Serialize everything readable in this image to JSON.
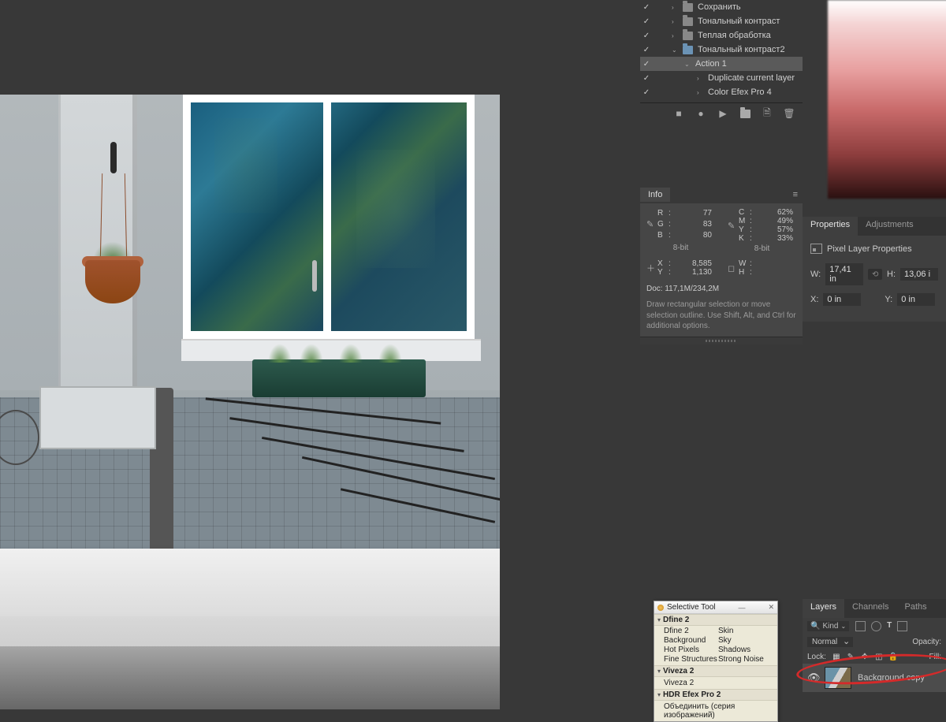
{
  "actions": {
    "items": [
      {
        "indent": 0,
        "checked": true,
        "caret": "›",
        "folder": "closed",
        "label": "Сохранить"
      },
      {
        "indent": 0,
        "checked": true,
        "caret": "›",
        "folder": "closed",
        "label": "Тональный контраст"
      },
      {
        "indent": 0,
        "checked": true,
        "caret": "›",
        "folder": "closed",
        "label": "Теплая обработка"
      },
      {
        "indent": 0,
        "checked": true,
        "caret": "⌄",
        "folder": "open",
        "label": "Тональный контраст2"
      },
      {
        "indent": 1,
        "checked": true,
        "caret": "⌄",
        "folder": "",
        "label": "Action 1",
        "selected": true
      },
      {
        "indent": 2,
        "checked": true,
        "caret": "›",
        "folder": "",
        "label": "Duplicate current layer"
      },
      {
        "indent": 2,
        "checked": true,
        "caret": "›",
        "folder": "",
        "label": "Color Efex Pro 4"
      }
    ],
    "toolbar": [
      "stop-icon",
      "record-icon",
      "play-icon",
      "new-set-icon",
      "new-action-icon",
      "trash-icon"
    ]
  },
  "info": {
    "title": "Info",
    "rgb": {
      "R": "77",
      "G": "83",
      "B": "80",
      "mode": "8-bit"
    },
    "cmyk": {
      "C": "62%",
      "M": "49%",
      "Y": "57%",
      "K": "33%",
      "mode": "8-bit"
    },
    "xy": {
      "X": "8,585",
      "Y": "1,130"
    },
    "wh": {
      "W": "",
      "H": ""
    },
    "doc": "Doc: 117,1M/234,2M",
    "hint": "Draw rectangular selection or move selection outline.  Use Shift, Alt, and Ctrl for additional options."
  },
  "properties": {
    "tabs": [
      "Properties",
      "Adjustments"
    ],
    "title": "Pixel Layer Properties",
    "W_label": "W:",
    "W": "17,41 in",
    "H_label": "H:",
    "H": "13,06 i",
    "X_label": "X:",
    "X": "0 in",
    "Y_label": "Y:",
    "Y": "0 in"
  },
  "layers": {
    "tabs": [
      "Layers",
      "Channels",
      "Paths"
    ],
    "kind_label": "Kind",
    "kind_icon": "🔍",
    "blend": "Normal",
    "opacity_label": "Opacity:",
    "lock_label": "Lock:",
    "fill_label": "Fill:",
    "layer0": "Background copy"
  },
  "selective": {
    "title": "Selective Tool",
    "sections": [
      {
        "head": "Dfine 2",
        "rows": [
          [
            "Dfine 2",
            "Skin"
          ],
          [
            "Background",
            "Sky"
          ],
          [
            "Hot Pixels",
            "Shadows"
          ],
          [
            "Fine Structures",
            "Strong Noise"
          ]
        ]
      },
      {
        "head": "Viveza 2",
        "single": "Viveza 2"
      },
      {
        "head": "HDR Efex Pro 2",
        "single": "Объединить (серия изображений)"
      }
    ]
  }
}
